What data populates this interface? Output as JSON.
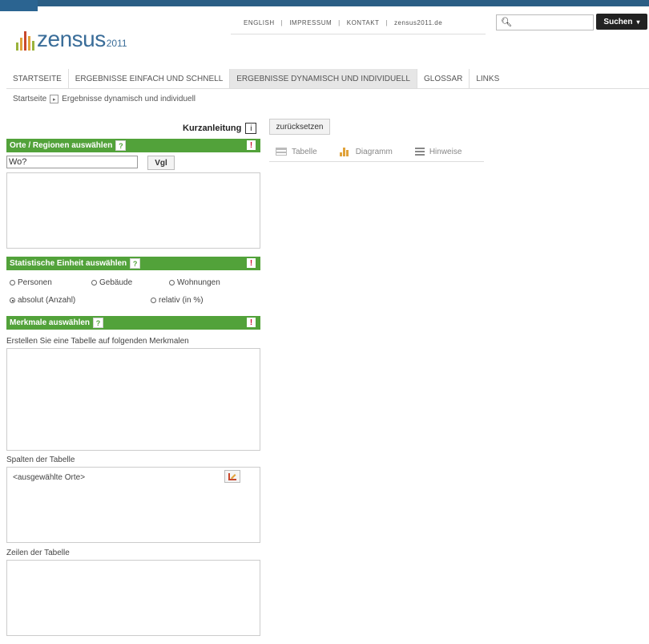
{
  "header": {
    "logo_text": "zensus",
    "logo_year": "2011",
    "topnav": [
      "ENGLISH",
      "IMPRESSUM",
      "KONTAKT",
      "zensus2011.de"
    ],
    "search_button": "Suchen",
    "search_icon": "search-icon"
  },
  "mainnav": {
    "tabs": [
      {
        "label": "STARTSEITE"
      },
      {
        "label": "ERGEBNISSE EINFACH UND SCHNELL"
      },
      {
        "label": "ERGEBNISSE DYNAMISCH UND INDIVIDUELL"
      },
      {
        "label": "GLOSSAR"
      },
      {
        "label": "LINKS"
      }
    ]
  },
  "breadcrumb": {
    "home": "Startseite",
    "current": "Ergebnisse dynamisch und individuell"
  },
  "left": {
    "kurzanleitung": "Kurzanleitung",
    "info_glyph": "i",
    "orte": {
      "title": "Orte / Regionen auswählen",
      "input_value": "Wo?",
      "vgl": "Vgl"
    },
    "einheit": {
      "title": "Statistische Einheit auswählen",
      "radios_row1": [
        "Personen",
        "Gebäude",
        "Wohnungen"
      ],
      "radio_abs": "absolut (Anzahl)",
      "radio_rel": "relativ (in %)"
    },
    "merkmale": {
      "title": "Merkmale auswählen",
      "hint": "Erstellen Sie eine Tabelle auf folgenden Merkmalen",
      "spalten_label": "Spalten der Tabelle",
      "spalten_value": "<ausgewählte Orte>",
      "zeilen_label": "Zeilen der Tabelle"
    },
    "qmark": "?",
    "excl": "!"
  },
  "right": {
    "reset": "zurücksetzen",
    "tabs": [
      "Tabelle",
      "Diagramm",
      "Hinweise"
    ]
  },
  "colors": {
    "green": "#52a23a",
    "blue": "#2b5e85",
    "excl_red": "#c8102e"
  }
}
